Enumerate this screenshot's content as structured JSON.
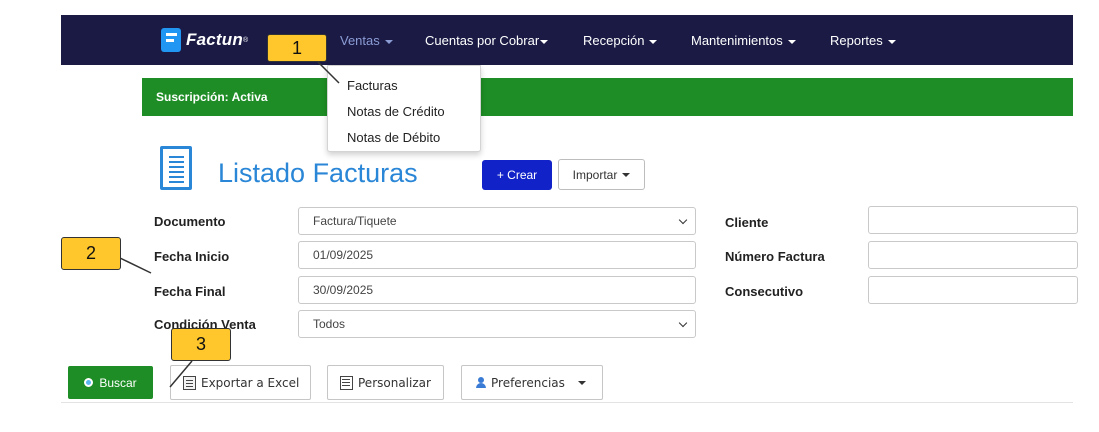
{
  "brand": {
    "name": "Factun",
    "mark": "®"
  },
  "nav": {
    "items": [
      {
        "label": "Ventas"
      },
      {
        "label": "Cuentas por Cobrar"
      },
      {
        "label": "Recepción"
      },
      {
        "label": "Mantenimientos"
      },
      {
        "label": "Reportes"
      }
    ]
  },
  "dropdown": {
    "items": [
      {
        "label": "Facturas"
      },
      {
        "label": "Notas de Crédito"
      },
      {
        "label": "Notas de Débito"
      }
    ]
  },
  "subscription": {
    "label": "Suscripción: Activa"
  },
  "page": {
    "title": "Listado Facturas",
    "create_label": "+ Crear",
    "import_label": "Importar"
  },
  "form": {
    "documento": {
      "label": "Documento",
      "value": "Factura/Tiquete"
    },
    "fecha_inicio": {
      "label": "Fecha Inicio",
      "value": "01/09/2025"
    },
    "fecha_final": {
      "label": "Fecha Final",
      "value": "30/09/2025"
    },
    "condicion_venta": {
      "label": "Condición Venta",
      "value": "Todos"
    },
    "cliente": {
      "label": "Cliente",
      "value": ""
    },
    "numero_factura": {
      "label": "Número Factura",
      "value": ""
    },
    "consecutivo": {
      "label": "Consecutivo",
      "value": ""
    }
  },
  "actions": {
    "search_label": "Buscar",
    "export_label": "Exportar a Excel",
    "customize_label": "Personalizar",
    "preferences_label": "Preferencias"
  },
  "callouts": [
    "1",
    "2",
    "3"
  ],
  "colors": {
    "navbar": "#1a1a45",
    "brand_blue": "#2196f3",
    "accent_blue": "#2a86d6",
    "create_button": "#1022c8",
    "success_green": "#1e8d25",
    "callout_yellow": "#ffc72b"
  }
}
